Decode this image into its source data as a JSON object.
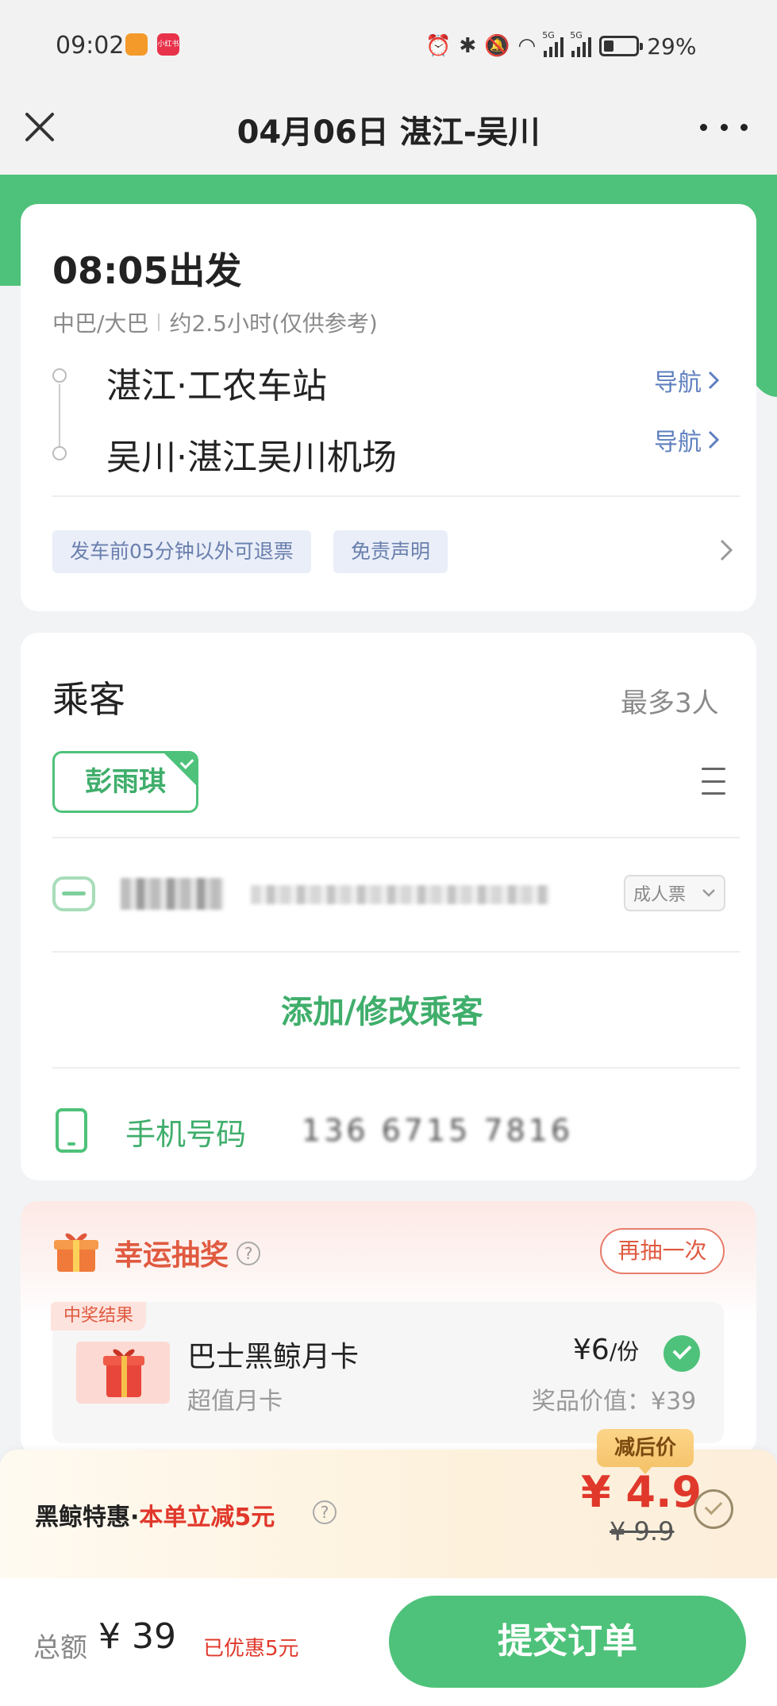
{
  "status_bar": {
    "time": "09:02",
    "app_icon2": "小红书",
    "signal_label": "5G",
    "battery": "29%",
    "battery_level_percent": 29
  },
  "header": {
    "title": "04月06日 湛江-吴川"
  },
  "trip": {
    "depart_time": "08:05出发",
    "bus_type": "中巴/大巴",
    "duration": "约2.5小时(仅供参考)",
    "from_station": "湛江·工农车站",
    "to_station": "吴川·湛江吴川机场",
    "nav_label": "导航",
    "refund_tag": "发车前05分钟以外可退票",
    "disclaimer_tag": "免责声明"
  },
  "passengers": {
    "title": "乘客",
    "max": "最多3人",
    "selected_chip": "彭雨琪",
    "ticket_type": "成人票",
    "add_label": "添加/修改乘客",
    "phone_label": "手机号码",
    "phone_number": "136 6715 7816"
  },
  "lottery": {
    "title": "幸运抽奖",
    "retry": "再抽一次",
    "result_badge": "中奖结果",
    "prize_name": "巴士黑鲸月卡",
    "prize_sub": "超值月卡",
    "prize_price": "¥6",
    "prize_unit": "/份",
    "prize_value": "奖品价值：¥39"
  },
  "promo": {
    "label_main": "黑鲸特惠",
    "label_sep": "·",
    "label_red": "本单立减5元",
    "badge": "减后价",
    "new_price": "¥ 4.9",
    "old_price": "¥ 9.9"
  },
  "footer": {
    "total_label": "总额",
    "total_value": "¥ 39",
    "discount": "已优惠5元",
    "submit": "提交订单"
  },
  "colors": {
    "brand_green": "#4ec27a",
    "accent_red": "#e0382b",
    "link_blue": "#5e7fbf"
  }
}
